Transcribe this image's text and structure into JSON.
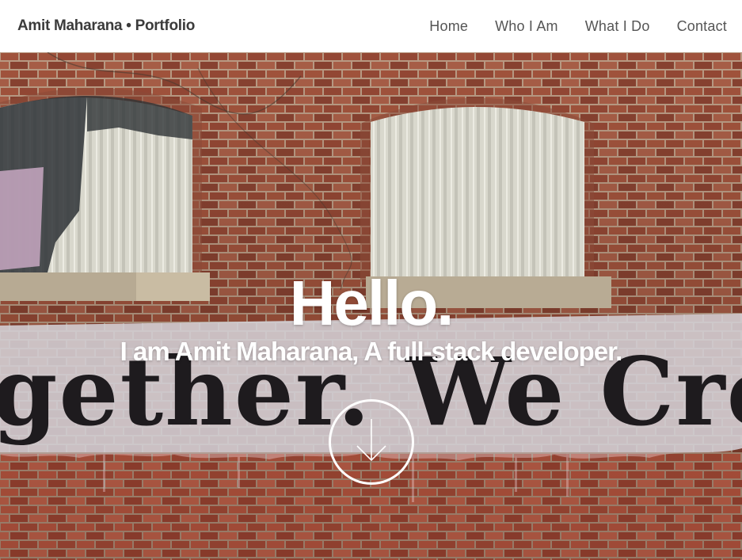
{
  "header": {
    "brand": "Amit Maharana • Portfolio",
    "nav": [
      {
        "label": "Home"
      },
      {
        "label": "Who I Am"
      },
      {
        "label": "What I Do"
      },
      {
        "label": "Contact"
      }
    ]
  },
  "hero": {
    "title": "Hello.",
    "subtitle": "I am Amit Maharana, A full-stack developer.",
    "scroll_icon": "arrow-down-circle-icon",
    "mural_text": "gether. We Crea"
  },
  "colors": {
    "brick": "#a4563f",
    "brick_dark": "#7a3a2a",
    "mortar": "#c6a78f",
    "shutter": "#d8d7cc",
    "text_white": "#ffffff",
    "nav_text": "#555555"
  }
}
